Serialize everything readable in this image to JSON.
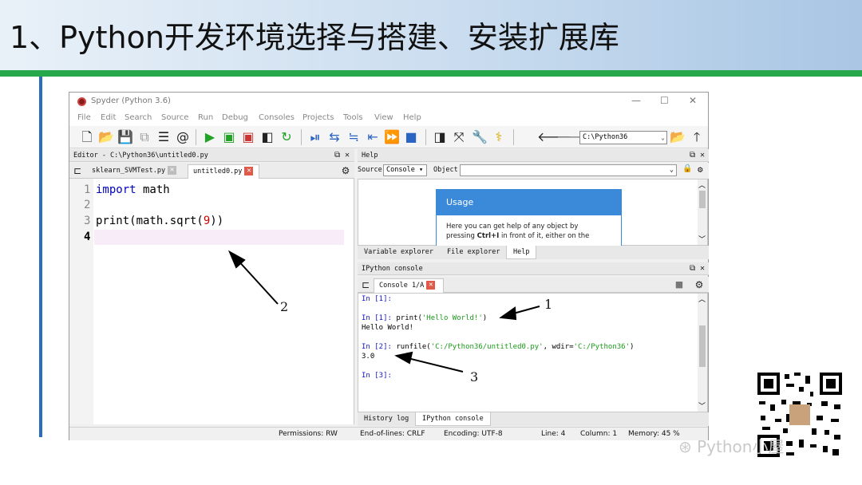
{
  "slide": {
    "title": "1、Python开发环境选择与搭建、安装扩展库",
    "watermark": "Python小屋"
  },
  "window": {
    "title": "Spyder (Python 3.6)",
    "controls": [
      "—",
      "☐",
      "✕"
    ]
  },
  "menubar": [
    "File",
    "Edit",
    "Search",
    "Source",
    "Run",
    "Debug",
    "Consoles",
    "Projects",
    "Tools",
    "View",
    "Help"
  ],
  "toolbar": {
    "working_dir": "C:\\Python36"
  },
  "editor": {
    "pane_title": "Editor - C:\\Python36\\untitled0.py",
    "tabs": [
      {
        "label": "sklearn_SVMTest.py",
        "close": "✕"
      },
      {
        "label": "untitled0.py",
        "close": "✕"
      }
    ],
    "line_numbers": [
      "1",
      "2",
      "3",
      "4"
    ],
    "code": {
      "l1_kw": "import",
      "l1_rest": " math",
      "l3_a": "print(math.sqrt(",
      "l3_num": "9",
      "l3_b": "))"
    }
  },
  "help": {
    "pane_title": "Help",
    "source_label": "Source",
    "source_value": "Console",
    "object_label": "Object",
    "usage_title": "Usage",
    "usage_text_1": "Here you can get help of any object by",
    "usage_text_2a": "pressing ",
    "usage_text_2b": "Ctrl+I",
    "usage_text_2c": " in front of it, either on the",
    "tabs": [
      "Variable explorer",
      "File explorer",
      "Help"
    ]
  },
  "console": {
    "pane_title": "IPython console",
    "tab_label": "Console 1/A",
    "lines": {
      "in1_empty": "In [1]:",
      "in1_prompt": "In [1]:",
      "in1_cmd_a": " print(",
      "in1_cmd_str": "'Hello World!'",
      "in1_cmd_b": ")",
      "out1": "Hello World!",
      "in2_prompt": "In [2]:",
      "in2_cmd_a": " runfile(",
      "in2_str1": "'C:/Python36/untitled0.py'",
      "in2_mid": ", wdir=",
      "in2_str2": "'C:/Python36'",
      "in2_end": ")",
      "out2": "3.0",
      "in3_prompt": "In [3]:"
    },
    "bottom_tabs": [
      "History log",
      "IPython console"
    ]
  },
  "statusbar": {
    "permissions": "Permissions:  RW",
    "eol": "End-of-lines:  CRLF",
    "encoding": "Encoding:  UTF-8",
    "line": "Line: 4",
    "column": "Column: 1",
    "memory": "Memory: 45 %"
  },
  "annotations": [
    "1",
    "2",
    "3"
  ]
}
